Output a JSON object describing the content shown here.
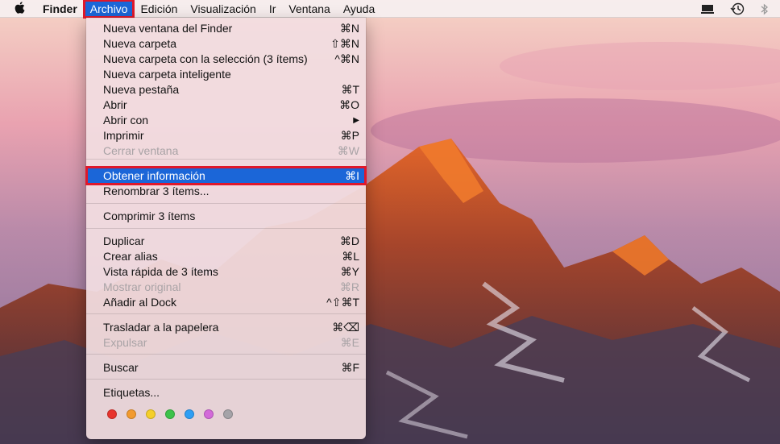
{
  "menubar": {
    "apple": "",
    "app": "Finder",
    "items": [
      "Archivo",
      "Edición",
      "Visualización",
      "Ir",
      "Ventana",
      "Ayuda"
    ]
  },
  "menu": {
    "items": [
      {
        "label": "Nueva ventana del Finder",
        "shortcut": "⌘N"
      },
      {
        "label": "Nueva carpeta",
        "shortcut": "⇧⌘N"
      },
      {
        "label": "Nueva carpeta con la selección (3 ítems)",
        "shortcut": "^⌘N"
      },
      {
        "label": "Nueva carpeta inteligente",
        "shortcut": ""
      },
      {
        "label": "Nueva pestaña",
        "shortcut": "⌘T"
      },
      {
        "label": "Abrir",
        "shortcut": "⌘O"
      },
      {
        "label": "Abrir con",
        "shortcut": "▶"
      },
      {
        "label": "Imprimir",
        "shortcut": "⌘P"
      },
      {
        "label": "Cerrar ventana",
        "shortcut": "⌘W"
      },
      {
        "label": "Obtener información",
        "shortcut": "⌘I"
      },
      {
        "label": "Renombrar 3 ítems...",
        "shortcut": ""
      },
      {
        "label": "Comprimir 3 ítems",
        "shortcut": ""
      },
      {
        "label": "Duplicar",
        "shortcut": "⌘D"
      },
      {
        "label": "Crear alias",
        "shortcut": "⌘L"
      },
      {
        "label": "Vista rápida de 3 ítems",
        "shortcut": "⌘Y"
      },
      {
        "label": "Mostrar original",
        "shortcut": "⌘R"
      },
      {
        "label": "Añadir al Dock",
        "shortcut": "^⇧⌘T"
      },
      {
        "label": "Trasladar a la papelera",
        "shortcut": "⌘⌫"
      },
      {
        "label": "Expulsar",
        "shortcut": "⌘E"
      },
      {
        "label": "Buscar",
        "shortcut": "⌘F"
      },
      {
        "label": "Etiquetas...",
        "shortcut": ""
      }
    ],
    "tag_colors": [
      "#e8342d",
      "#f29a2e",
      "#f5cf2a",
      "#3dc24a",
      "#2e9ef4",
      "#d36ad9",
      "#a5a3a8"
    ]
  },
  "icons": [
    "apple-icon",
    "display-icon",
    "time-machine-icon",
    "bluetooth-icon"
  ],
  "colors": {
    "highlight": "#1b66d8",
    "annotation": "#e0182b"
  }
}
